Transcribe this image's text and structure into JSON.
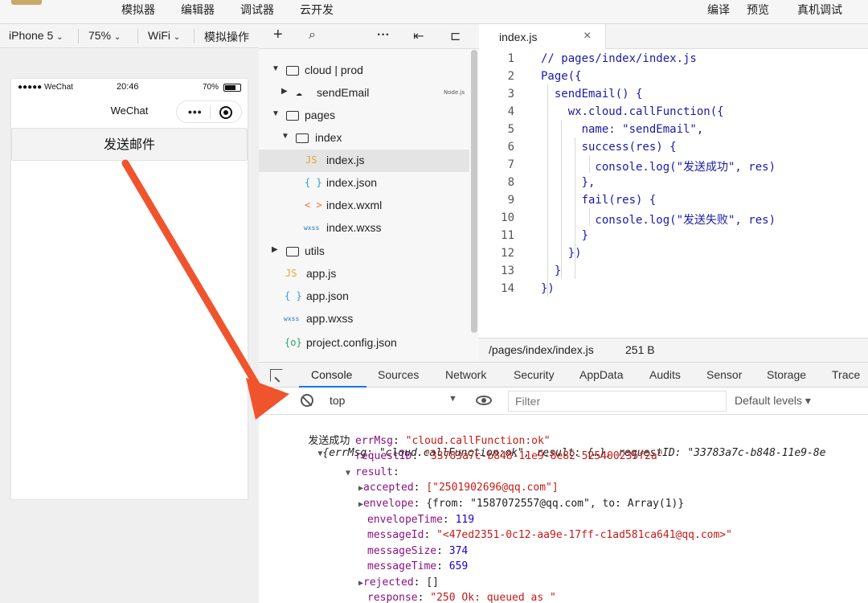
{
  "menubar": {
    "items": [
      "模拟器",
      "编辑器",
      "调试器",
      "云开发"
    ],
    "right_items": [
      "编译",
      "预览",
      "真机调试"
    ]
  },
  "simulator_toolbar": {
    "device": "iPhone 5",
    "zoom": "75%",
    "network": "WiFi",
    "simulate": "模拟操作"
  },
  "phone": {
    "status_left": "●●●●● WeChat",
    "status_time": "20:46",
    "status_battery": "70%",
    "nav_title": "WeChat",
    "capsule_dots": "•••",
    "button_label": "发送邮件"
  },
  "file_tree": {
    "items": [
      {
        "name": "cloud | prod",
        "type": "cloud-folder"
      },
      {
        "name": "sendEmail",
        "type": "cloud-function",
        "badge": "Node.js"
      },
      {
        "name": "pages",
        "type": "folder"
      },
      {
        "name": "index",
        "type": "folder"
      },
      {
        "name": "index.js",
        "type": "js",
        "icon": "JS"
      },
      {
        "name": "index.json",
        "type": "json",
        "icon": "{ }"
      },
      {
        "name": "index.wxml",
        "type": "wxml",
        "icon": "< >"
      },
      {
        "name": "index.wxss",
        "type": "wxss",
        "icon": "wxss"
      },
      {
        "name": "utils",
        "type": "folder"
      },
      {
        "name": "app.js",
        "type": "js",
        "icon": "JS"
      },
      {
        "name": "app.json",
        "type": "json",
        "icon": "{ }"
      },
      {
        "name": "app.wxss",
        "type": "wxss",
        "icon": "wxss"
      },
      {
        "name": "project.config.json",
        "type": "config",
        "icon": "{o}"
      }
    ]
  },
  "editor": {
    "tab_name": "index.js",
    "close_symbol": "×",
    "line_numbers": [
      "1",
      "2",
      "3",
      "4",
      "5",
      "6",
      "7",
      "8",
      "9",
      "10",
      "11",
      "12",
      "13",
      "14"
    ],
    "lines": [
      "// pages/index/index.js",
      "Page({",
      "  sendEmail() {",
      "    wx.cloud.callFunction({",
      "      name: \"sendEmail\",",
      "      success(res) {",
      "        console.log(\"发送成功\", res)",
      "      },",
      "      fail(res) {",
      "        console.log(\"发送失败\", res)",
      "      }",
      "    })",
      "  }",
      "})"
    ],
    "status_path": "/pages/index/index.js",
    "status_size": "251 B"
  },
  "devtools": {
    "tabs": [
      "Console",
      "Sources",
      "Network",
      "Security",
      "AppData",
      "Audits",
      "Sensor",
      "Storage",
      "Trace"
    ],
    "active_tab": "Console",
    "context": "top",
    "filter_placeholder": "Filter",
    "levels": "Default levels ▾",
    "log_label": "发送成功",
    "log_summary": "{errMsg: \"cloud.callFunction:ok\", result: {…}, requestID: \"33783a7c-b848-11e9-8e",
    "entries": [
      {
        "key": "errMsg",
        "value": "\"cloud.callFunction:ok\"",
        "kind": "str"
      },
      {
        "key": "requestID",
        "value": "\"33783a7c-b848-11e9-8e82-525400235f2a\"",
        "kind": "str"
      },
      {
        "key": "result",
        "value": "",
        "kind": "obj"
      },
      {
        "key": "accepted",
        "value": "[\"2501902696@qq.com\"]",
        "kind": "arr"
      },
      {
        "key": "envelope",
        "value": "{from: \"1587072557@qq.com\", to: Array(1)}",
        "kind": "obj2"
      },
      {
        "key": "envelopeTime",
        "value": "119",
        "kind": "num"
      },
      {
        "key": "messageId",
        "value": "\"<47ed2351-0c12-aa9e-17ff-c1ad581ca641@qq.com>\"",
        "kind": "str"
      },
      {
        "key": "messageSize",
        "value": "374",
        "kind": "num"
      },
      {
        "key": "messageTime",
        "value": "659",
        "kind": "num"
      },
      {
        "key": "rejected",
        "value": "[]",
        "kind": "arr"
      },
      {
        "key": "response",
        "value": "\"250 Ok: queued as \"",
        "kind": "str"
      }
    ]
  },
  "colors": {
    "accent_arrow": "#f0542d",
    "string": "#c41a16",
    "key": "#881280",
    "number": "#1c00cf",
    "comment": "#2e8b57"
  }
}
